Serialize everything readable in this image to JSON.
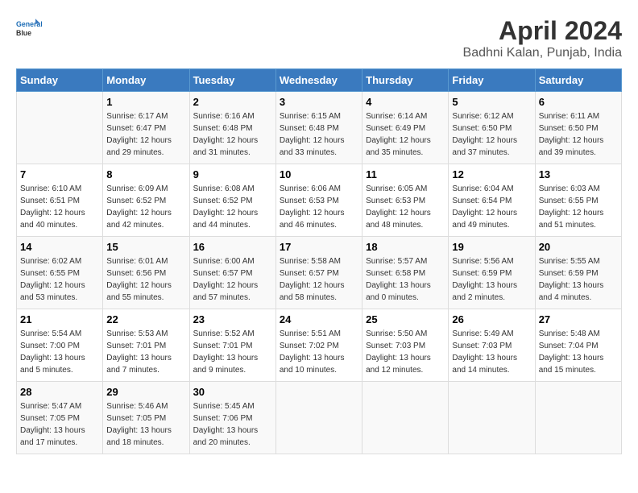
{
  "header": {
    "logo_line1": "General",
    "logo_line2": "Blue",
    "title": "April 2024",
    "subtitle": "Badhni Kalan, Punjab, India"
  },
  "days_of_week": [
    "Sunday",
    "Monday",
    "Tuesday",
    "Wednesday",
    "Thursday",
    "Friday",
    "Saturday"
  ],
  "weeks": [
    [
      {
        "day": "",
        "info": ""
      },
      {
        "day": "1",
        "info": "Sunrise: 6:17 AM\nSunset: 6:47 PM\nDaylight: 12 hours\nand 29 minutes."
      },
      {
        "day": "2",
        "info": "Sunrise: 6:16 AM\nSunset: 6:48 PM\nDaylight: 12 hours\nand 31 minutes."
      },
      {
        "day": "3",
        "info": "Sunrise: 6:15 AM\nSunset: 6:48 PM\nDaylight: 12 hours\nand 33 minutes."
      },
      {
        "day": "4",
        "info": "Sunrise: 6:14 AM\nSunset: 6:49 PM\nDaylight: 12 hours\nand 35 minutes."
      },
      {
        "day": "5",
        "info": "Sunrise: 6:12 AM\nSunset: 6:50 PM\nDaylight: 12 hours\nand 37 minutes."
      },
      {
        "day": "6",
        "info": "Sunrise: 6:11 AM\nSunset: 6:50 PM\nDaylight: 12 hours\nand 39 minutes."
      }
    ],
    [
      {
        "day": "7",
        "info": "Sunrise: 6:10 AM\nSunset: 6:51 PM\nDaylight: 12 hours\nand 40 minutes."
      },
      {
        "day": "8",
        "info": "Sunrise: 6:09 AM\nSunset: 6:52 PM\nDaylight: 12 hours\nand 42 minutes."
      },
      {
        "day": "9",
        "info": "Sunrise: 6:08 AM\nSunset: 6:52 PM\nDaylight: 12 hours\nand 44 minutes."
      },
      {
        "day": "10",
        "info": "Sunrise: 6:06 AM\nSunset: 6:53 PM\nDaylight: 12 hours\nand 46 minutes."
      },
      {
        "day": "11",
        "info": "Sunrise: 6:05 AM\nSunset: 6:53 PM\nDaylight: 12 hours\nand 48 minutes."
      },
      {
        "day": "12",
        "info": "Sunrise: 6:04 AM\nSunset: 6:54 PM\nDaylight: 12 hours\nand 49 minutes."
      },
      {
        "day": "13",
        "info": "Sunrise: 6:03 AM\nSunset: 6:55 PM\nDaylight: 12 hours\nand 51 minutes."
      }
    ],
    [
      {
        "day": "14",
        "info": "Sunrise: 6:02 AM\nSunset: 6:55 PM\nDaylight: 12 hours\nand 53 minutes."
      },
      {
        "day": "15",
        "info": "Sunrise: 6:01 AM\nSunset: 6:56 PM\nDaylight: 12 hours\nand 55 minutes."
      },
      {
        "day": "16",
        "info": "Sunrise: 6:00 AM\nSunset: 6:57 PM\nDaylight: 12 hours\nand 57 minutes."
      },
      {
        "day": "17",
        "info": "Sunrise: 5:58 AM\nSunset: 6:57 PM\nDaylight: 12 hours\nand 58 minutes."
      },
      {
        "day": "18",
        "info": "Sunrise: 5:57 AM\nSunset: 6:58 PM\nDaylight: 13 hours\nand 0 minutes."
      },
      {
        "day": "19",
        "info": "Sunrise: 5:56 AM\nSunset: 6:59 PM\nDaylight: 13 hours\nand 2 minutes."
      },
      {
        "day": "20",
        "info": "Sunrise: 5:55 AM\nSunset: 6:59 PM\nDaylight: 13 hours\nand 4 minutes."
      }
    ],
    [
      {
        "day": "21",
        "info": "Sunrise: 5:54 AM\nSunset: 7:00 PM\nDaylight: 13 hours\nand 5 minutes."
      },
      {
        "day": "22",
        "info": "Sunrise: 5:53 AM\nSunset: 7:01 PM\nDaylight: 13 hours\nand 7 minutes."
      },
      {
        "day": "23",
        "info": "Sunrise: 5:52 AM\nSunset: 7:01 PM\nDaylight: 13 hours\nand 9 minutes."
      },
      {
        "day": "24",
        "info": "Sunrise: 5:51 AM\nSunset: 7:02 PM\nDaylight: 13 hours\nand 10 minutes."
      },
      {
        "day": "25",
        "info": "Sunrise: 5:50 AM\nSunset: 7:03 PM\nDaylight: 13 hours\nand 12 minutes."
      },
      {
        "day": "26",
        "info": "Sunrise: 5:49 AM\nSunset: 7:03 PM\nDaylight: 13 hours\nand 14 minutes."
      },
      {
        "day": "27",
        "info": "Sunrise: 5:48 AM\nSunset: 7:04 PM\nDaylight: 13 hours\nand 15 minutes."
      }
    ],
    [
      {
        "day": "28",
        "info": "Sunrise: 5:47 AM\nSunset: 7:05 PM\nDaylight: 13 hours\nand 17 minutes."
      },
      {
        "day": "29",
        "info": "Sunrise: 5:46 AM\nSunset: 7:05 PM\nDaylight: 13 hours\nand 18 minutes."
      },
      {
        "day": "30",
        "info": "Sunrise: 5:45 AM\nSunset: 7:06 PM\nDaylight: 13 hours\nand 20 minutes."
      },
      {
        "day": "",
        "info": ""
      },
      {
        "day": "",
        "info": ""
      },
      {
        "day": "",
        "info": ""
      },
      {
        "day": "",
        "info": ""
      }
    ]
  ]
}
